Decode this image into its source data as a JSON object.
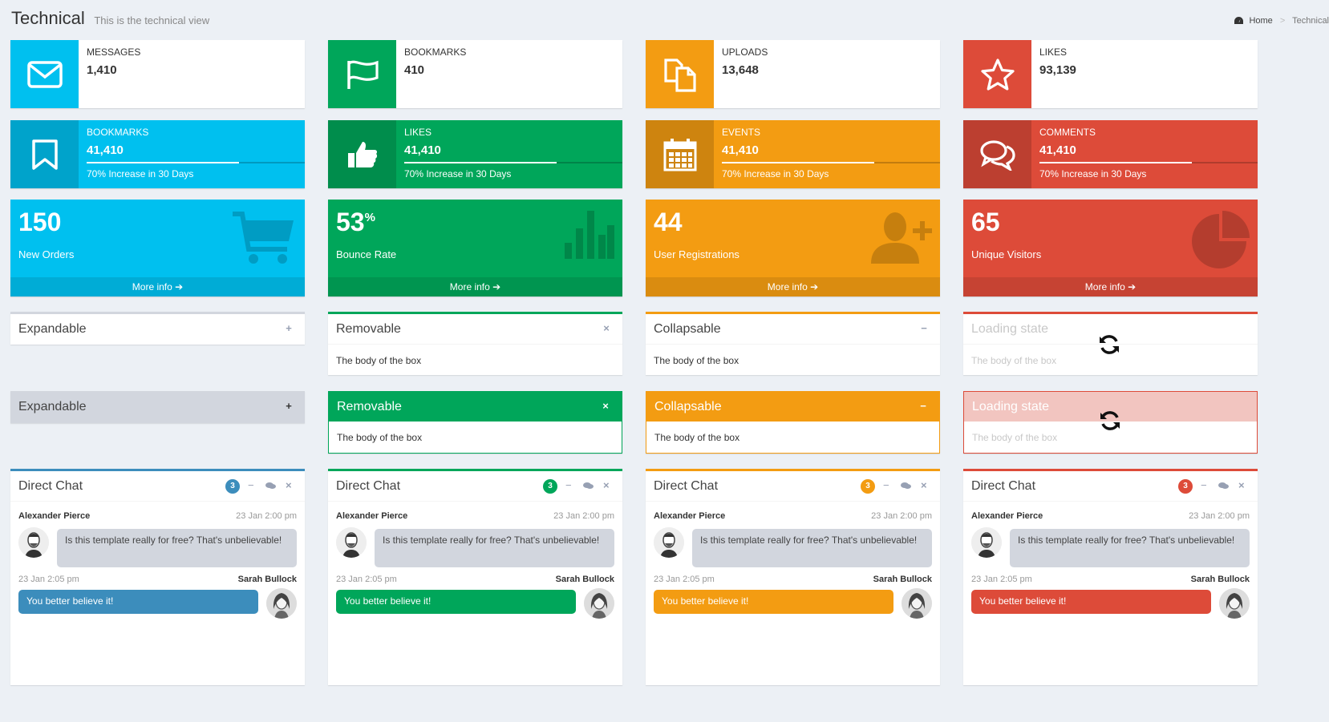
{
  "header": {
    "title": "Technical",
    "subtitle": "This is the technical view",
    "breadcrumb": {
      "home": "Home",
      "current": "Technical"
    }
  },
  "colors": {
    "aqua": "#00c0ef",
    "green": "#00a65a",
    "yellow": "#f39c12",
    "red": "#dd4b39",
    "blue": "#3c8dbc"
  },
  "info_boxes": [
    {
      "label": "MESSAGES",
      "value": "1,410",
      "icon": "envelope-icon"
    },
    {
      "label": "BOOKMARKS",
      "value": "410",
      "icon": "flag-icon"
    },
    {
      "label": "UPLOADS",
      "value": "13,648",
      "icon": "files-icon"
    },
    {
      "label": "LIKES",
      "value": "93,139",
      "icon": "star-icon"
    }
  ],
  "solid_info_boxes": [
    {
      "label": "BOOKMARKS",
      "value": "41,410",
      "progress": 0.7,
      "desc": "70% Increase in 30 Days",
      "icon": "bookmark-icon"
    },
    {
      "label": "LIKES",
      "value": "41,410",
      "progress": 0.7,
      "desc": "70% Increase in 30 Days",
      "icon": "thumbs-up-icon"
    },
    {
      "label": "EVENTS",
      "value": "41,410",
      "progress": 0.7,
      "desc": "70% Increase in 30 Days",
      "icon": "calendar-icon"
    },
    {
      "label": "COMMENTS",
      "value": "41,410",
      "progress": 0.7,
      "desc": "70% Increase in 30 Days",
      "icon": "comments-icon"
    }
  ],
  "small_boxes": [
    {
      "number": "150",
      "sup": "",
      "label": "New Orders",
      "footer": "More info",
      "icon": "cart-icon"
    },
    {
      "number": "53",
      "sup": "%",
      "label": "Bounce Rate",
      "footer": "More info",
      "icon": "bar-chart-icon"
    },
    {
      "number": "44",
      "sup": "",
      "label": "User Registrations",
      "footer": "More info",
      "icon": "user-plus-icon"
    },
    {
      "number": "65",
      "sup": "",
      "label": "Unique Visitors",
      "footer": "More info",
      "icon": "pie-chart-icon"
    }
  ],
  "boxes_row1": [
    {
      "title": "Expandable",
      "body": ""
    },
    {
      "title": "Removable",
      "body": "The body of the box"
    },
    {
      "title": "Collapsable",
      "body": "The body of the box"
    },
    {
      "title": "Loading state",
      "body": "The body of the box"
    }
  ],
  "boxes_row2": [
    {
      "title": "Expandable",
      "body": ""
    },
    {
      "title": "Removable",
      "body": "The body of the box"
    },
    {
      "title": "Collapsable",
      "body": "The body of the box"
    },
    {
      "title": "Loading state",
      "body": "The body of the box"
    }
  ],
  "chat": {
    "title": "Direct Chat",
    "badge": "3",
    "msg1": {
      "name": "Alexander Pierce",
      "time": "23 Jan 2:00 pm",
      "text": "Is this template really for free? That's unbelievable!"
    },
    "msg2": {
      "name": "Sarah Bullock",
      "time": "23 Jan 2:05 pm",
      "text": "You better believe it!"
    }
  },
  "more_info_arrow": "➔"
}
